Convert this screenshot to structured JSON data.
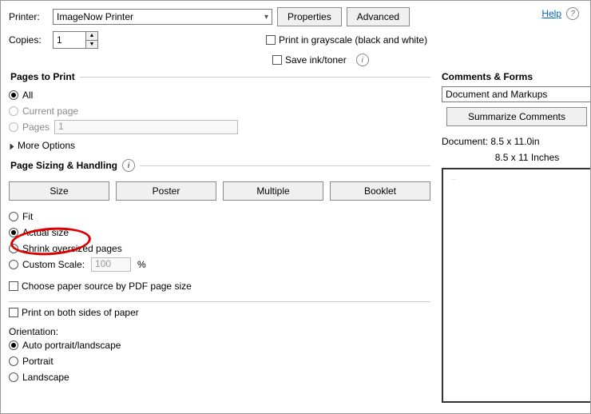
{
  "help": {
    "label": "Help"
  },
  "printer": {
    "label": "Printer:",
    "value": "ImageNow Printer",
    "properties": "Properties",
    "advanced": "Advanced"
  },
  "copies": {
    "label": "Copies:",
    "value": "1"
  },
  "opts": {
    "grayscale": "Print in grayscale (black and white)",
    "saveink": "Save ink/toner"
  },
  "pages": {
    "header": "Pages to Print",
    "all": "All",
    "current": "Current page",
    "pages": "Pages",
    "pages_val": "1",
    "more": "More Options"
  },
  "sizing": {
    "header": "Page Sizing & Handling",
    "size": "Size",
    "poster": "Poster",
    "multiple": "Multiple",
    "booklet": "Booklet",
    "fit": "Fit",
    "actual": "Actual size",
    "shrink": "Shrink oversized pages",
    "custom": "Custom Scale:",
    "custom_val": "100",
    "pct": "%",
    "paper_source": "Choose paper source by PDF page size"
  },
  "duplex": "Print on both sides of paper",
  "orient": {
    "label": "Orientation:",
    "auto": "Auto portrait/landscape",
    "portrait": "Portrait",
    "landscape": "Landscape"
  },
  "comments": {
    "header": "Comments & Forms",
    "value": "Document and Markups",
    "summarize": "Summarize Comments",
    "doc": "Document: 8.5 x 11.0in",
    "preview": "8.5 x 11 Inches"
  }
}
